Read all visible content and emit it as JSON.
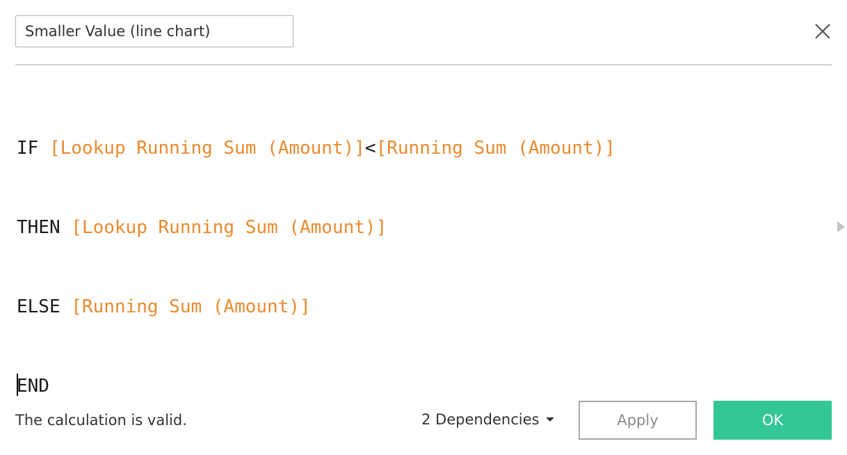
{
  "header": {
    "calculation_name": "Smaller Value (line chart)"
  },
  "formula": {
    "line1": {
      "keyword": "IF ",
      "field_a": "[Lookup Running Sum (Amount)]",
      "operator": "<",
      "field_b": "[Running Sum (Amount)]"
    },
    "line2": {
      "keyword": "THEN ",
      "field": "[Lookup Running Sum (Amount)]"
    },
    "line3": {
      "keyword": "ELSE ",
      "field": "[Running Sum (Amount)]"
    },
    "line4": {
      "keyword": "END"
    }
  },
  "footer": {
    "status": "The calculation is valid.",
    "dependencies_label": "2 Dependencies",
    "apply_label": "Apply",
    "ok_label": "OK"
  },
  "colors": {
    "field": "#ea8a2f",
    "ok_button": "#33c795"
  },
  "icons": {
    "close": "close-icon",
    "dependencies": "caret-down-icon",
    "expander": "triangle-right-icon"
  }
}
